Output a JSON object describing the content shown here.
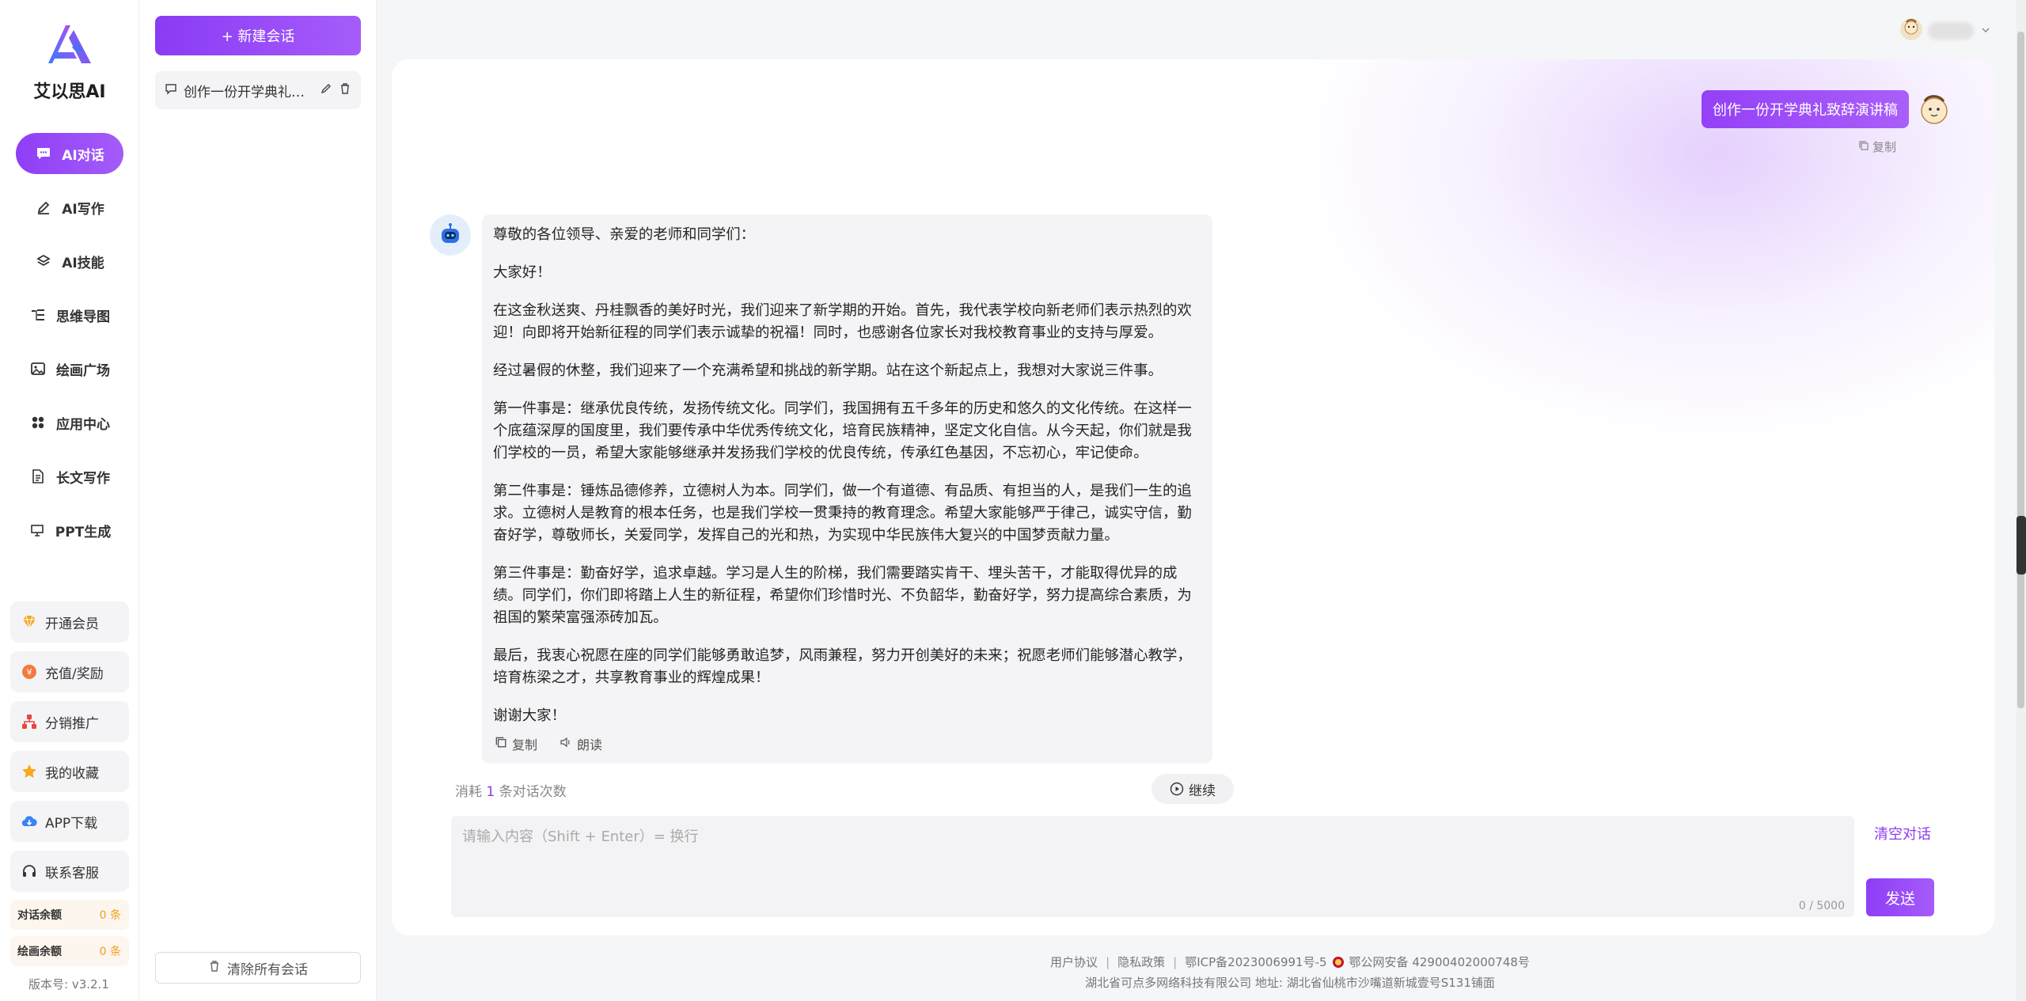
{
  "app": {
    "brand": "艾以思AI",
    "version": "版本号: v3.2.1"
  },
  "nav": {
    "items": [
      {
        "label": "AI对话",
        "icon": "chat-bubble-icon",
        "active": true
      },
      {
        "label": "AI写作",
        "icon": "pen-icon"
      },
      {
        "label": "AI技能",
        "icon": "layers-icon"
      },
      {
        "label": "思维导图",
        "icon": "mind-map-icon"
      },
      {
        "label": "绘画广场",
        "icon": "image-icon"
      },
      {
        "label": "应用中心",
        "icon": "apps-grid-icon"
      },
      {
        "label": "长文写作",
        "icon": "document-icon"
      },
      {
        "label": "PPT生成",
        "icon": "presentation-icon"
      }
    ],
    "side_buttons": [
      {
        "label": "开通会员",
        "icon": "vip-diamond-icon"
      },
      {
        "label": "充值/奖励",
        "icon": "recharge-coin-icon"
      },
      {
        "label": "分销推广",
        "icon": "org-chart-icon"
      },
      {
        "label": "我的收藏",
        "icon": "star-icon"
      },
      {
        "label": "APP下载",
        "icon": "cloud-download-icon"
      },
      {
        "label": "联系客服",
        "icon": "headset-icon"
      }
    ],
    "balances": [
      {
        "label": "对话余额",
        "value": "0 条"
      },
      {
        "label": "绘画余额",
        "value": "0 条"
      }
    ]
  },
  "conversations": {
    "new_button": "+ 新建会话",
    "items": [
      {
        "title": "创作一份开学典礼致辞演讲稿"
      }
    ],
    "clear_all": "清除所有会话"
  },
  "chat": {
    "user_message": "创作一份开学典礼致辞演讲稿",
    "user_copy": "复制",
    "bot_paragraphs": [
      "尊敬的各位领导、亲爱的老师和同学们：",
      "大家好！",
      "在这金秋送爽、丹桂飘香的美好时光，我们迎来了新学期的开始。首先，我代表学校向新老师们表示热烈的欢迎！向即将开始新征程的同学们表示诚挚的祝福！同时，也感谢各位家长对我校教育事业的支持与厚爱。",
      "经过暑假的休整，我们迎来了一个充满希望和挑战的新学期。站在这个新起点上，我想对大家说三件事。",
      "第一件事是：继承优良传统，发扬传统文化。同学们，我国拥有五千多年的历史和悠久的文化传统。在这样一个底蕴深厚的国度里，我们要传承中华优秀传统文化，培育民族精神，坚定文化自信。从今天起，你们就是我们学校的一员，希望大家能够继承并发扬我们学校的优良传统，传承红色基因，不忘初心，牢记使命。",
      "第二件事是：锤炼品德修养，立德树人为本。同学们，做一个有道德、有品质、有担当的人，是我们一生的追求。立德树人是教育的根本任务，也是我们学校一贯秉持的教育理念。希望大家能够严于律己，诚实守信，勤奋好学，尊敬师长，关爱同学，发挥自己的光和热，为实现中华民族伟大复兴的中国梦贡献力量。",
      "第三件事是：勤奋好学，追求卓越。学习是人生的阶梯，我们需要踏实肯干、埋头苦干，才能取得优异的成绩。同学们，你们即将踏上人生的新征程，希望你们珍惜时光、不负韶华，勤奋好学，努力提高综合素质，为祖国的繁荣富强添砖加瓦。",
      "最后，我衷心祝愿在座的同学们能够勇敢追梦，风雨兼程，努力开创美好的未来；祝愿老师们能够潜心教学，培育栋梁之才，共享教育事业的辉煌成果！",
      "谢谢大家！"
    ],
    "bot_copy": "复制",
    "bot_read": "朗读",
    "usage_prefix": "消耗",
    "usage_count": "1",
    "usage_suffix": "条对话次数",
    "continue": "继续",
    "input_placeholder": "请输入内容（Shift + Enter）= 换行",
    "char_count": "0 / 5000",
    "clear_chat": "清空对话",
    "send": "发送"
  },
  "footer": {
    "user_agreement": "用户协议",
    "privacy": "隐私政策",
    "icp": "鄂ICP备2023006991号-5",
    "police": "鄂公网安备 42900402000748号",
    "company": "湖北省可点多网络科技有限公司  地址: 湖北省仙桃市沙嘴道新城壹号S131铺面"
  },
  "colors": {
    "accent": "#8a3bf5",
    "balance_value": "#f0a020"
  }
}
